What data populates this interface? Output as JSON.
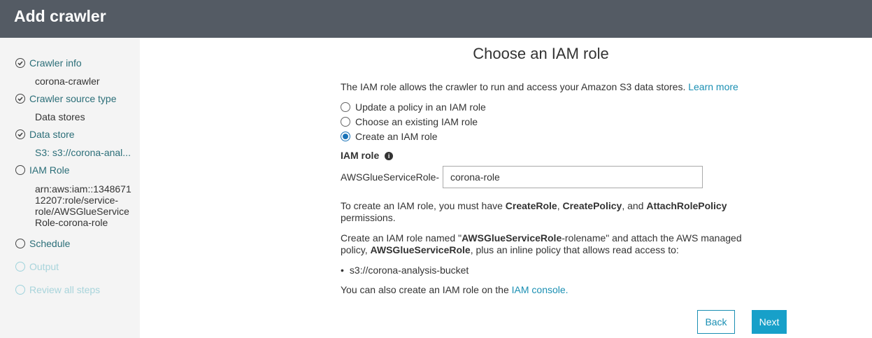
{
  "header": {
    "title": "Add crawler"
  },
  "sidebar": {
    "steps": [
      {
        "label": "Crawler info",
        "status": "done",
        "detail": [
          "corona-crawler"
        ]
      },
      {
        "label": "Crawler source type",
        "status": "done",
        "detail": [
          "Data stores"
        ]
      },
      {
        "label": "Data store",
        "status": "done",
        "detail": [
          "S3: s3://corona-anal..."
        ]
      },
      {
        "label": "IAM Role",
        "status": "current",
        "detail": [
          "arn:aws:iam::1348671",
          "12207:role/service-",
          "role/AWSGlueService",
          "Role-corona-role"
        ]
      },
      {
        "label": "Schedule",
        "status": "pending",
        "detail": []
      },
      {
        "label": "Output",
        "status": "disabled",
        "detail": []
      },
      {
        "label": "Review all steps",
        "status": "disabled",
        "detail": []
      }
    ]
  },
  "main": {
    "title": "Choose an IAM role",
    "intro": "The IAM role allows the crawler to run and access your Amazon S3 data stores.",
    "learn_more": "Learn more",
    "options": [
      {
        "label": "Update a policy in an IAM role",
        "selected": false
      },
      {
        "label": "Choose an existing IAM role",
        "selected": false
      },
      {
        "label": "Create an IAM role",
        "selected": true
      }
    ],
    "iam_role_label": "IAM role",
    "prefix": "AWSGlueServiceRole-",
    "role_value": "corona-role",
    "perm_text_1": "To create an IAM role, you must have ",
    "perm_create_role": "CreateRole",
    "perm_comma": ", ",
    "perm_create_policy": "CreatePolicy",
    "perm_and": ", and ",
    "perm_attach": "AttachRolePolicy",
    "perm_text_2": "permissions.",
    "create_text_1": "Create an IAM role named \"",
    "create_name_bold": "AWSGlueServiceRole",
    "create_text_2": "-rolename\" and attach the AWS managed",
    "create_text_3": "policy, ",
    "create_policy_bold": "AWSGlueServiceRole",
    "create_text_4": ", plus an inline policy that allows read access to:",
    "bucket": "s3://corona-analysis-bucket",
    "console_text": "You can also create an IAM role on the ",
    "console_link": "IAM console.",
    "back_label": "Back",
    "next_label": "Next"
  },
  "colors": {
    "header_bg": "#545b64",
    "link": "#1a8fb3",
    "primary_button": "#17a0c9",
    "radio_selected": "#1a73b8"
  }
}
